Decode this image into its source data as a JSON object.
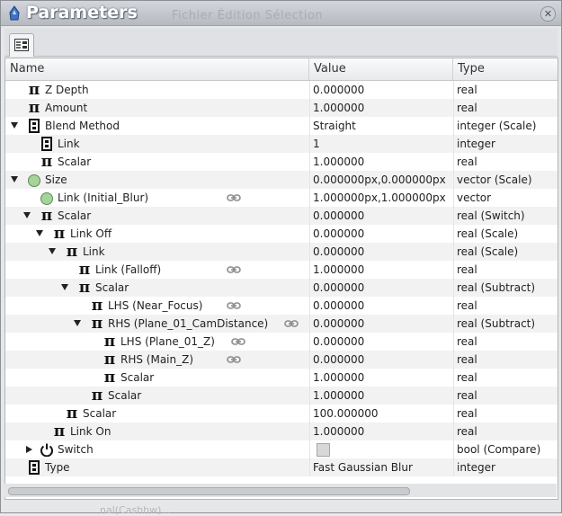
{
  "window": {
    "title": "Parameters",
    "background_menu_ghost": "Fichier   Édition   Sélection",
    "footer_ghost": "nal(Cashhw)..."
  },
  "columns": {
    "name": "Name",
    "value": "Value",
    "type": "Type"
  },
  "rows": [
    {
      "name": "Z Depth",
      "value": "0.000000",
      "type": "real",
      "icon": "pi-icon",
      "expander": "none",
      "indent": 0,
      "linked": false
    },
    {
      "name": "Amount",
      "value": "1.000000",
      "type": "real",
      "icon": "pi-icon",
      "expander": "none",
      "indent": 0,
      "linked": false
    },
    {
      "name": "Blend Method",
      "value": "Straight",
      "type": "integer (Scale)",
      "icon": "integer-icon",
      "expander": "down",
      "indent": 0,
      "linked": false
    },
    {
      "name": "Link",
      "value": "1",
      "type": "integer",
      "icon": "integer-icon",
      "expander": "none",
      "indent": 1,
      "linked": false
    },
    {
      "name": "Scalar",
      "value": "1.000000",
      "type": "real",
      "icon": "pi-icon",
      "expander": "none",
      "indent": 1,
      "linked": false
    },
    {
      "name": "Size",
      "value": "0.000000px,0.000000px",
      "type": "vector (Scale)",
      "icon": "vector-icon",
      "expander": "down",
      "indent": 0,
      "linked": false
    },
    {
      "name": "Link (Initial_Blur)",
      "value": "1.000000px,1.000000px",
      "type": "vector",
      "icon": "vector-icon",
      "expander": "none",
      "indent": 1,
      "linked": true
    },
    {
      "name": "Scalar",
      "value": "0.000000",
      "type": "real (Switch)",
      "icon": "pi-icon",
      "expander": "down",
      "indent": 1,
      "linked": false
    },
    {
      "name": "Link Off",
      "value": "0.000000",
      "type": "real (Scale)",
      "icon": "pi-icon",
      "expander": "down",
      "indent": 2,
      "linked": false
    },
    {
      "name": "Link",
      "value": "0.000000",
      "type": "real (Scale)",
      "icon": "pi-icon",
      "expander": "down",
      "indent": 3,
      "linked": false
    },
    {
      "name": "Link (Falloff)",
      "value": "1.000000",
      "type": "real",
      "icon": "pi-icon",
      "expander": "none",
      "indent": 4,
      "linked": true
    },
    {
      "name": "Scalar",
      "value": "0.000000",
      "type": "real (Subtract)",
      "icon": "pi-icon",
      "expander": "down",
      "indent": 4,
      "linked": false
    },
    {
      "name": "LHS (Near_Focus)",
      "value": "0.000000",
      "type": "real",
      "icon": "pi-icon",
      "expander": "none",
      "indent": 5,
      "linked": true
    },
    {
      "name": "RHS (Plane_01_CamDistance)",
      "value": "0.000000",
      "type": "real (Subtract)",
      "icon": "pi-icon",
      "expander": "down",
      "indent": 5,
      "linked": true
    },
    {
      "name": "LHS (Plane_01_Z)",
      "value": "0.000000",
      "type": "real",
      "icon": "pi-icon",
      "expander": "none",
      "indent": 6,
      "linked": true
    },
    {
      "name": "RHS (Main_Z)",
      "value": "0.000000",
      "type": "real",
      "icon": "pi-icon",
      "expander": "none",
      "indent": 6,
      "linked": true
    },
    {
      "name": "Scalar",
      "value": "1.000000",
      "type": "real",
      "icon": "pi-icon",
      "expander": "none",
      "indent": 6,
      "linked": false
    },
    {
      "name": "Scalar",
      "value": "1.000000",
      "type": "real",
      "icon": "pi-icon",
      "expander": "none",
      "indent": 5,
      "linked": false
    },
    {
      "name": "Scalar",
      "value": "100.000000",
      "type": "real",
      "icon": "pi-icon",
      "expander": "none",
      "indent": 3,
      "linked": false
    },
    {
      "name": "Link On",
      "value": "1.000000",
      "type": "real",
      "icon": "pi-icon",
      "expander": "none",
      "indent": 2,
      "linked": false
    },
    {
      "name": "Switch",
      "value": "",
      "type": "bool (Compare)",
      "icon": "power-icon",
      "expander": "right",
      "indent": 1,
      "linked": false,
      "checkbox": true
    },
    {
      "name": "Type",
      "value": "Fast Gaussian Blur",
      "type": "integer",
      "icon": "integer-icon",
      "expander": "none",
      "indent": 0,
      "linked": false
    }
  ]
}
